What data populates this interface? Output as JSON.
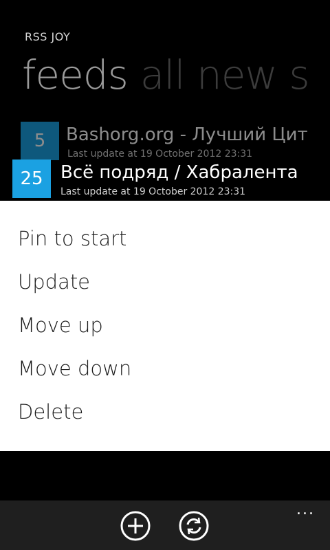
{
  "app": {
    "title": "RSS JOY"
  },
  "pivot": {
    "active": "feeds",
    "inactive": "all new s"
  },
  "feeds": [
    {
      "count": "5",
      "title": "Bashorg.org - Лучший Цит",
      "subtitle": "Last update at 19 October 2012 23:31"
    },
    {
      "count": "25",
      "title": "Всё подряд / Хабралента",
      "subtitle": "Last update at 19 October 2012 23:31"
    }
  ],
  "context_menu": {
    "items": [
      "Pin to start",
      "Update",
      "Move up",
      "Move down",
      "Delete"
    ]
  },
  "app_bar": {
    "buttons": [
      {
        "icon": "add-icon"
      },
      {
        "icon": "sync-icon"
      }
    ],
    "more": "..."
  },
  "colors": {
    "accent": "#1ba1e2",
    "background": "#000000",
    "menu_background": "#ffffff",
    "app_bar": "#1f1f1f"
  }
}
